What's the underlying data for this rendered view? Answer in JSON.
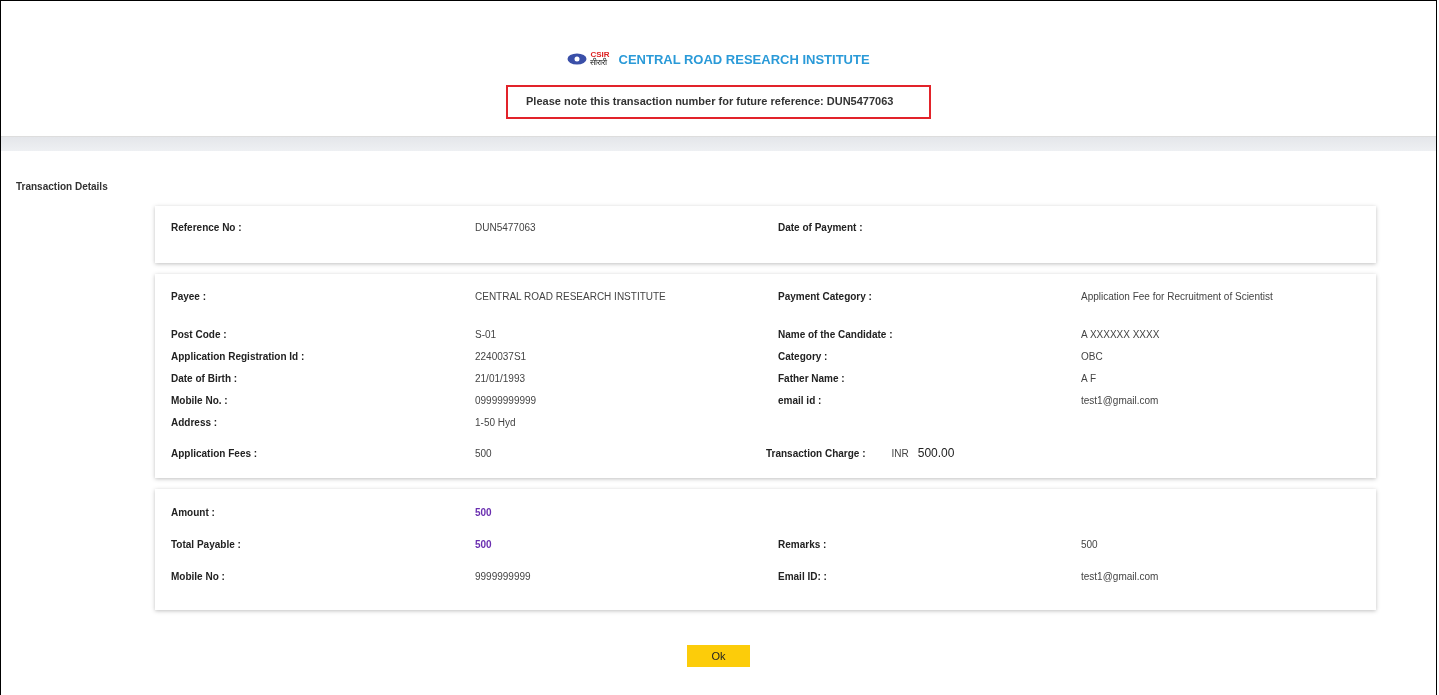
{
  "header": {
    "institute": "CENTRAL ROAD RESEARCH INSTITUTE",
    "logo_text": "CSIR",
    "logo_subtext": "सीरारी",
    "notice": "Please note this transaction number for future reference: DUN5477063"
  },
  "section_title": "Transaction Details",
  "cards": [
    {
      "kind": "reference",
      "rows": [
        {
          "kind": "pair",
          "left": {
            "label": "Reference No :",
            "value": "DUN5477063"
          },
          "right": {
            "label": "Date of Payment :"
          }
        }
      ]
    },
    {
      "kind": "details",
      "rows": [
        {
          "kind": "pair",
          "left": {
            "label": "Payee :",
            "value": "CENTRAL ROAD RESEARCH INSTITUTE"
          },
          "right": {
            "label": "Payment Category :",
            "value": "Application Fee for Recruitment of Scientist"
          }
        },
        {
          "kind": "pair",
          "left": {
            "label": "Post Code :",
            "value": "S-01"
          },
          "right": {
            "label": "Name of the Candidate :",
            "value": "A XXXXXX XXXX"
          }
        },
        {
          "kind": "pair",
          "left": {
            "label": "Application Registration Id :",
            "value": "2240037S1"
          },
          "right": {
            "label": "Category :",
            "value": "OBC"
          }
        },
        {
          "kind": "pair",
          "left": {
            "label": "Date of Birth :",
            "value": "21/01/1993"
          },
          "right": {
            "label": "Father Name :",
            "value": "A F"
          }
        },
        {
          "kind": "pair",
          "left": {
            "label": "Mobile No. :",
            "value": "09999999999"
          },
          "right": {
            "label": "email id :",
            "value": "test1@gmail.com"
          }
        },
        {
          "kind": "pair",
          "left": {
            "label": "Address :",
            "value": "1-50 Hyd"
          }
        },
        {
          "kind": "charge",
          "left": {
            "label": "Application Fees :",
            "value": "500"
          },
          "right": {
            "label": "Transaction Charge :",
            "currency": "INR",
            "value": "500.00"
          }
        }
      ]
    },
    {
      "kind": "summary",
      "rows": [
        {
          "kind": "pair",
          "left": {
            "label": "Amount :",
            "value": "500",
            "highlight": true
          }
        },
        {
          "kind": "pair",
          "left": {
            "label": "Total Payable :",
            "value": "500",
            "highlight": true
          },
          "right": {
            "label": "Remarks :",
            "value": "500"
          }
        },
        {
          "kind": "pair",
          "left": {
            "label": "Mobile No :",
            "value": "9999999999"
          },
          "right": {
            "label": "Email ID: :",
            "value": "test1@gmail.com"
          }
        }
      ]
    }
  ],
  "ok_button": "Ok"
}
